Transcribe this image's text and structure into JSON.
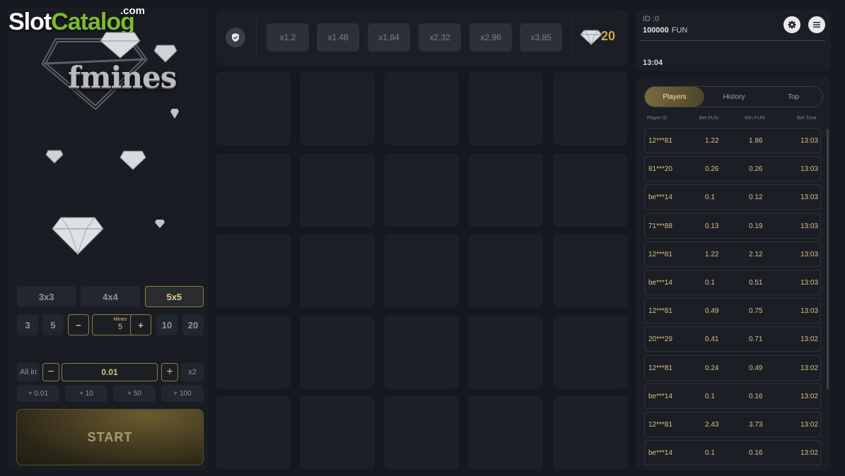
{
  "watermark": {
    "slot": "Slot",
    "catalog": "Catalog",
    "com": ".com"
  },
  "logo": {
    "text": "fmines"
  },
  "grid_sizes": [
    {
      "label": "3x3",
      "active": false
    },
    {
      "label": "4x4",
      "active": false
    },
    {
      "label": "5x5",
      "active": true
    }
  ],
  "mines": {
    "preset_low_1": "3",
    "preset_low_2": "5",
    "minus": "−",
    "label": "Mines",
    "value": "5",
    "plus": "+",
    "preset_high_1": "10",
    "preset_high_2": "20"
  },
  "bet": {
    "all_in": "All in",
    "minus": "−",
    "value": "0.01",
    "plus": "+",
    "double": "x2",
    "adds": [
      "+ 0.01",
      "+ 10",
      "+ 50",
      "+ 100"
    ]
  },
  "start_label": "START",
  "multipliers": [
    "x1.2",
    "x1.48",
    "x1.84",
    "x2.32",
    "x2.96",
    "x3.85"
  ],
  "diamond_count": "20",
  "account": {
    "id_label": "ID :0",
    "balance": "100000",
    "currency": "FUN",
    "time": "13:04"
  },
  "tabs": [
    {
      "label": "Players",
      "active": true
    },
    {
      "label": "History",
      "active": false
    },
    {
      "label": "Top",
      "active": false
    }
  ],
  "table_headers": {
    "player": "Player ID",
    "bet": "Bet FUN",
    "win": "Win FUN",
    "time": "Bet Time"
  },
  "players": [
    {
      "id": "12***81",
      "bet": "1.22",
      "win": "1.86",
      "time": "13:03"
    },
    {
      "id": "81***20",
      "bet": "0.26",
      "win": "0.26",
      "time": "13:03"
    },
    {
      "id": "be***14",
      "bet": "0.1",
      "win": "0.12",
      "time": "13:03"
    },
    {
      "id": "71***88",
      "bet": "0.13",
      "win": "0.19",
      "time": "13:03"
    },
    {
      "id": "12***81",
      "bet": "1.22",
      "win": "2.12",
      "time": "13:03"
    },
    {
      "id": "be***14",
      "bet": "0.1",
      "win": "0.51",
      "time": "13:03"
    },
    {
      "id": "12***81",
      "bet": "0.49",
      "win": "0.75",
      "time": "13:03"
    },
    {
      "id": "20***29",
      "bet": "0.41",
      "win": "0.71",
      "time": "13:02"
    },
    {
      "id": "12***81",
      "bet": "0.24",
      "win": "0.49",
      "time": "13:02"
    },
    {
      "id": "be***14",
      "bet": "0.1",
      "win": "0.16",
      "time": "13:02"
    },
    {
      "id": "12***81",
      "bet": "2.43",
      "win": "3.73",
      "time": "13:02"
    },
    {
      "id": "be***14",
      "bet": "0.1",
      "win": "0.16",
      "time": "13:02"
    }
  ],
  "colors": {
    "gold": "#d6c187",
    "accent": "#cfa64a",
    "panel": "#1b1e24",
    "tile": "#1c1f25"
  }
}
